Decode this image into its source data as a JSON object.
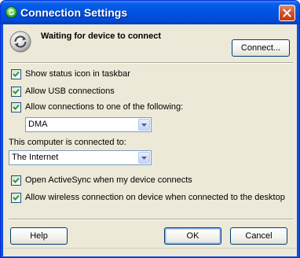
{
  "window": {
    "title": "Connection Settings"
  },
  "header": {
    "status_text": "Waiting for device to connect",
    "connect_label": "Connect..."
  },
  "options": {
    "show_status_icon": {
      "label": "Show status icon in taskbar",
      "checked": true
    },
    "allow_usb": {
      "label": "Allow USB connections",
      "checked": true
    },
    "allow_connections": {
      "label": "Allow connections to one of the following:",
      "checked": true
    },
    "connection_port": {
      "selected": "DMA"
    },
    "connected_to_label": "This computer is connected to:",
    "connected_to": {
      "selected": "The Internet"
    },
    "open_activesync": {
      "label": "Open ActiveSync when my device connects",
      "checked": true
    },
    "allow_wireless": {
      "label": "Allow wireless connection on device when connected to the desktop",
      "checked": true
    }
  },
  "footer": {
    "help_label": "Help",
    "ok_label": "OK",
    "cancel_label": "Cancel"
  },
  "colors": {
    "titlebar": "#0054e3",
    "dialog_bg": "#ece9d8",
    "close": "#d35029",
    "checkmark": "#21a121"
  },
  "icons": {
    "title": "activesync-icon",
    "header": "sync-arrows-icon",
    "close": "close-icon"
  }
}
